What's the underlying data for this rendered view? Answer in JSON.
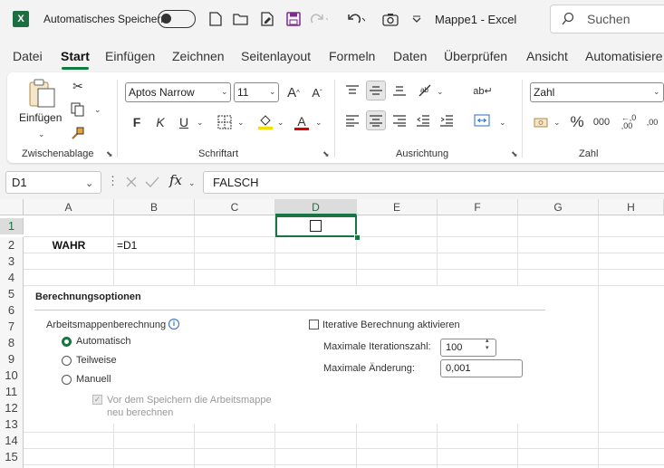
{
  "titlebar": {
    "app_logo": "X",
    "autosave_label": "Automatisches Speichern",
    "document_title": "Mappe1  -  Excel",
    "search_placeholder": "Suchen"
  },
  "menu": {
    "items": [
      "Datei",
      "Start",
      "Einfügen",
      "Zeichnen",
      "Seitenlayout",
      "Formeln",
      "Daten",
      "Überprüfen",
      "Ansicht",
      "Automatisiere"
    ],
    "active": "Start"
  },
  "ribbon": {
    "clipboard": {
      "paste_label": "Einfügen",
      "group_label": "Zwischenablage"
    },
    "font": {
      "font_name": "Aptos Narrow",
      "font_size": "11",
      "bold": "F",
      "italic": "K",
      "underline": "U",
      "font_color_letter": "A",
      "group_label": "Schriftart"
    },
    "alignment": {
      "group_label": "Ausrichtung"
    },
    "number": {
      "format": "Zahl",
      "percent": "%",
      "thousands": "000",
      "group_label": "Zahl"
    }
  },
  "formula_bar": {
    "name_box": "D1",
    "fx_label": "fx",
    "formula": "FALSCH"
  },
  "grid": {
    "columns": [
      "A",
      "B",
      "C",
      "D",
      "E",
      "F",
      "G",
      "H"
    ],
    "rows": [
      "1",
      "2",
      "3",
      "4",
      "5",
      "6",
      "7",
      "8",
      "9",
      "10",
      "11",
      "12",
      "13",
      "14",
      "15"
    ],
    "selected_cell": "D1",
    "cells": {
      "A2": "WAHR",
      "B2": "=D1"
    }
  },
  "dialog": {
    "title": "Berechnungsoptionen",
    "workbook_calc_label": "Arbeitsmappenberechnung",
    "options": [
      "Automatisch",
      "Teilweise",
      "Manuell"
    ],
    "selected_option": "Automatisch",
    "recalc_before_save": "Vor dem Speichern die Arbeitsmappe neu berechnen",
    "recalc_line1": "Vor dem Speichern die Arbeitsmappe",
    "recalc_line2": "neu berechnen",
    "iterative_label": "Iterative Berechnung aktivieren",
    "max_iterations_label": "Maximale Iterationszahl:",
    "max_iterations_value": "100",
    "max_change_label": "Maximale Änderung:",
    "max_change_value": "0,001"
  },
  "colors": {
    "accent": "#1a7343",
    "excel_green": "#1d6f42"
  }
}
